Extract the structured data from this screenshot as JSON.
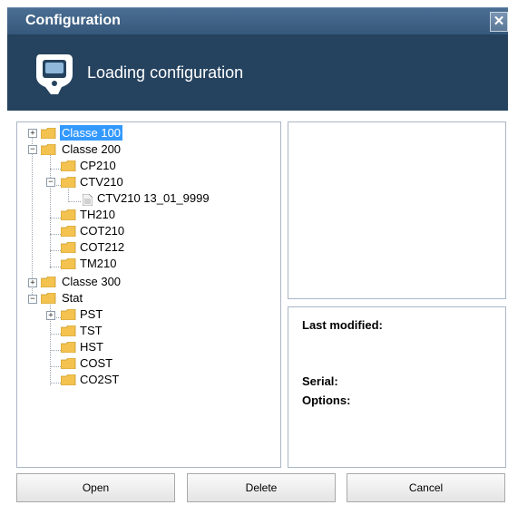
{
  "window": {
    "title": "Configuration",
    "close_glyph": "✕"
  },
  "header": {
    "text": "Loading configuration",
    "icon": "device-icon"
  },
  "tree": [
    {
      "id": "classe100",
      "label": "Classe 100",
      "selected": true
    },
    {
      "id": "classe200",
      "label": "Classe 200"
    },
    {
      "id": "cp210",
      "label": "CP210"
    },
    {
      "id": "ctv210",
      "label": "CTV210"
    },
    {
      "id": "ctv210file",
      "label": "CTV210 13_01_9999"
    },
    {
      "id": "th210",
      "label": "TH210"
    },
    {
      "id": "cot210",
      "label": "COT210"
    },
    {
      "id": "cot212",
      "label": "COT212"
    },
    {
      "id": "tm210",
      "label": "TM210"
    },
    {
      "id": "classe300",
      "label": "Classe 300"
    },
    {
      "id": "stat",
      "label": "Stat"
    },
    {
      "id": "pst",
      "label": "PST"
    },
    {
      "id": "tst",
      "label": "TST"
    },
    {
      "id": "hst",
      "label": "HST"
    },
    {
      "id": "cost",
      "label": "COST"
    },
    {
      "id": "co2st",
      "label": "CO2ST"
    }
  ],
  "info": {
    "last_modified": "Last modified:",
    "serial": "Serial:",
    "options": "Options:"
  },
  "buttons": {
    "open": "Open",
    "delete": "Delete",
    "cancel": "Cancel"
  },
  "colors": {
    "title_bar": "#35577a",
    "header_bg": "#25435f",
    "selection": "#3399ff",
    "folder": "#f3c24f"
  }
}
